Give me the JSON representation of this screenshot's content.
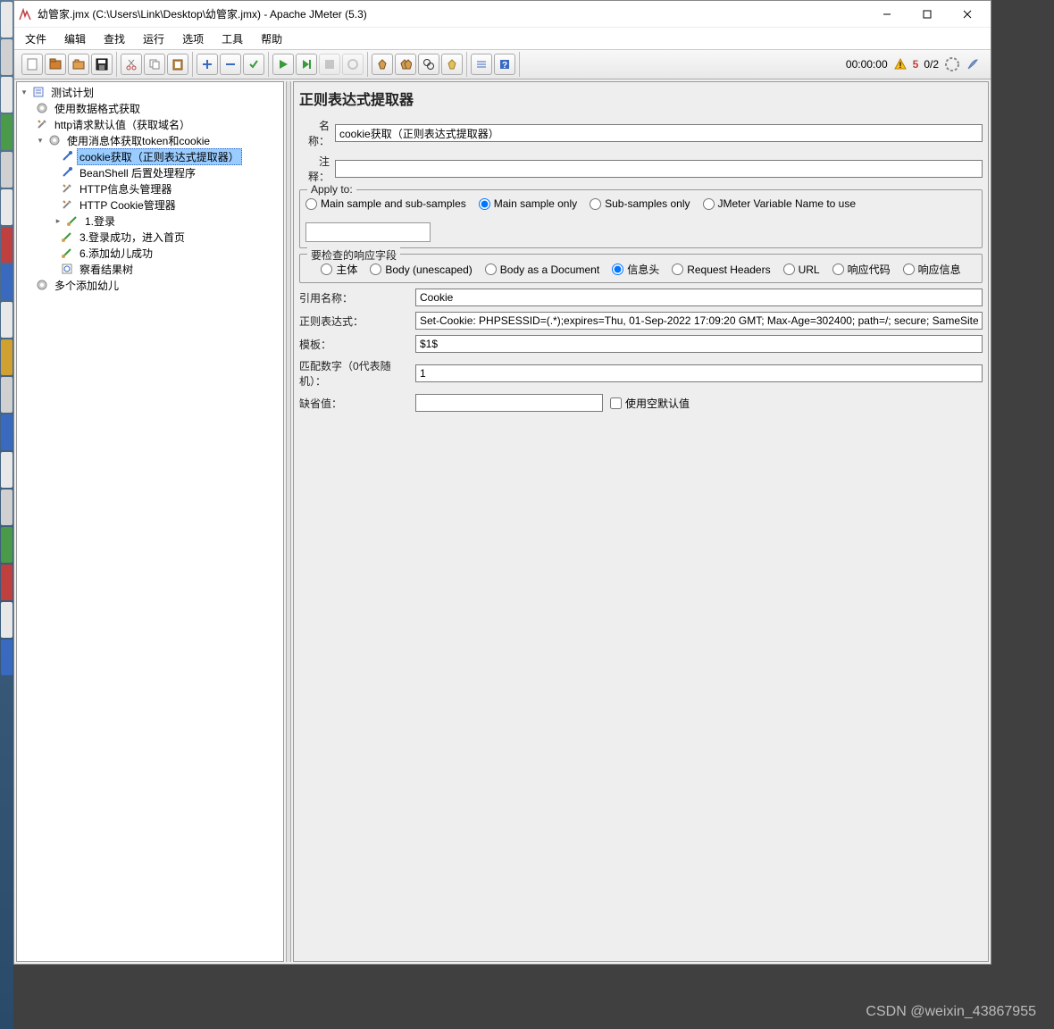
{
  "window": {
    "title": "幼管家.jmx (C:\\Users\\Link\\Desktop\\幼管家.jmx) - Apache JMeter (5.3)"
  },
  "menu": {
    "file": "文件",
    "edit": "编辑",
    "search": "查找",
    "run": "运行",
    "options": "选项",
    "tools": "工具",
    "help": "帮助"
  },
  "status": {
    "time": "00:00:00",
    "warn_count": "5",
    "threads": "0/2"
  },
  "tree": {
    "root": "测试计划",
    "n1": "使用数据格式获取",
    "n2": "http请求默认值（获取域名）",
    "n3": "使用消息体获取token和cookie",
    "n3_1": "cookie获取（正则表达式提取器）",
    "n3_2": "BeanShell 后置处理程序",
    "n3_3": "HTTP信息头管理器",
    "n3_4": "HTTP Cookie管理器",
    "n4": "1.登录",
    "n5": "3.登录成功，进入首页",
    "n6": "6.添加幼儿成功",
    "n7": "察看结果树",
    "n8": "多个添加幼儿"
  },
  "panel": {
    "heading": "正则表达式提取器",
    "name_label": "名称：",
    "name_value": "cookie获取（正则表达式提取器）",
    "comment_label": "注释：",
    "comment_value": "",
    "apply_legend": "Apply to:",
    "apply_opts": {
      "o1": "Main sample and sub-samples",
      "o2": "Main sample only",
      "o3": "Sub-samples only",
      "o4": "JMeter Variable Name to use"
    },
    "field_legend": "要检查的响应字段",
    "field_opts": {
      "o1": "主体",
      "o2": "Body (unescaped)",
      "o3": "Body as a Document",
      "o4": "信息头",
      "o5": "Request Headers",
      "o6": "URL",
      "o7": "响应代码",
      "o8": "响应信息"
    },
    "refname_label": "引用名称：",
    "refname_value": "Cookie",
    "regex_label": "正则表达式：",
    "regex_value": "Set-Cookie: PHPSESSID=(.*);expires=Thu, 01-Sep-2022 17:09:20 GMT; Max-Age=302400; path=/; secure; SameSite=None",
    "template_label": "模板：",
    "template_value": "$1$",
    "match_label": "匹配数字（0代表随机）：",
    "match_value": "1",
    "default_label": "缺省值：",
    "default_value": "",
    "use_empty_label": "使用空默认值"
  },
  "watermark": "CSDN @weixin_43867955"
}
